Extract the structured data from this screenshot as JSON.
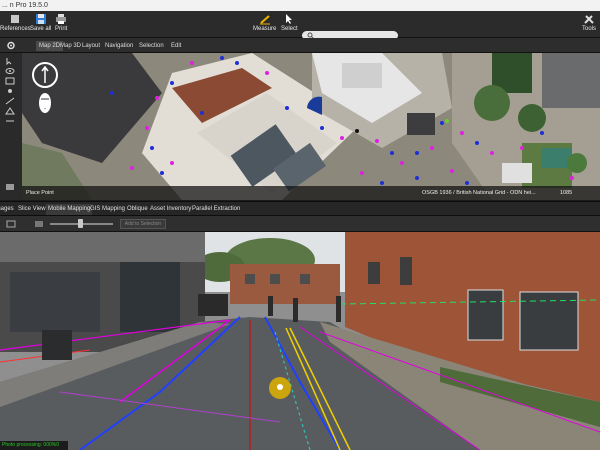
{
  "window": {
    "title": "... n Pro 19.5.0"
  },
  "ribbon": {
    "references_label": "References",
    "save_all_label": "Save all",
    "print_label": "Print",
    "measure_label": "Measure",
    "select_label": "Select",
    "tools_label": "Tools",
    "search_placeholder": ""
  },
  "map_toolbar": {
    "settings_label": "",
    "map2d": "Map 2D",
    "map3d": "Map 3D",
    "layout": "Layout",
    "navigation": "Navigation",
    "selection": "Selection",
    "edit": "Edit"
  },
  "map_status": {
    "left": "Place Point",
    "crs": "OSGB 1936 / British National Grid - ODN hei...",
    "value": "1085"
  },
  "panel_tabs": [
    {
      "label": "Images"
    },
    {
      "label": "Slice View"
    },
    {
      "label": "Mobile Mapping"
    },
    {
      "label": "GIS Mapping"
    },
    {
      "label": "Oblique"
    },
    {
      "label": "Asset Inventory"
    },
    {
      "label": "Parallel Extraction"
    }
  ],
  "mobile_toolbar": {
    "add_button": "Add to Selection"
  },
  "status": {
    "bottom_left": "Photo processing: 000%0"
  },
  "colors": {
    "accent_green": "#29c729",
    "road_line_blue": "#2040ff",
    "road_line_magenta": "#e000e0"
  }
}
